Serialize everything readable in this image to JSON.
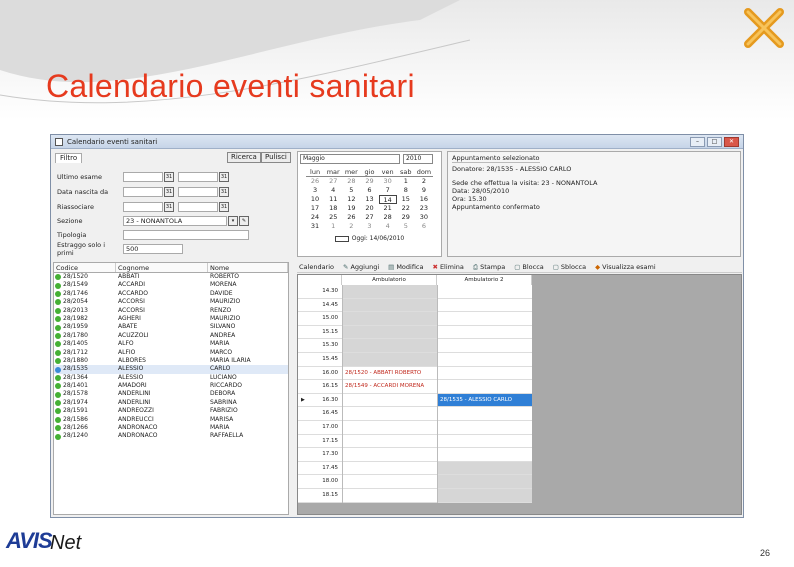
{
  "slide": {
    "title": "Calendario eventi sanitari",
    "page_number": "26",
    "logo_text_1": "AVIS",
    "logo_text_2": "Net"
  },
  "window": {
    "title": "Calendario eventi sanitari",
    "min": "–",
    "max": "□",
    "close": "✕"
  },
  "filter": {
    "tab": "Filtro",
    "buttons": {
      "search": "Ricerca",
      "clear": "Pulisci"
    },
    "fields": [
      {
        "label": "Ultimo esame",
        "value": ""
      },
      {
        "label": "Data nascita da",
        "value": ""
      },
      {
        "label": "Riassociare",
        "value": ""
      },
      {
        "label": "Sezione",
        "value": "23 - NONANTOLA"
      },
      {
        "label": "Tipologia",
        "value": ""
      },
      {
        "label": "Estraggo solo i primi",
        "value": "500"
      }
    ]
  },
  "calendar": {
    "month": "Maggio",
    "year": "2010",
    "days": [
      "lun",
      "mar",
      "mer",
      "gio",
      "ven",
      "sab",
      "dom"
    ],
    "weeks": [
      [
        "26",
        "27",
        "28",
        "29",
        "30",
        "1",
        "2"
      ],
      [
        "3",
        "4",
        "5",
        "6",
        "7",
        "8",
        "9"
      ],
      [
        "10",
        "11",
        "12",
        "13",
        "14",
        "15",
        "16"
      ],
      [
        "17",
        "18",
        "19",
        "20",
        "21",
        "22",
        "23"
      ],
      [
        "24",
        "25",
        "26",
        "27",
        "28",
        "29",
        "30"
      ],
      [
        "31",
        "1",
        "2",
        "3",
        "4",
        "5",
        "6"
      ]
    ],
    "today_label": "Oggi: 14/06/2010"
  },
  "appointment": {
    "header": "Appuntamento selezionato",
    "donor": "Donatore: 28/1535 - ALESSIO CARLO",
    "site": "Sede che effettua la visita: 23 - NONANTOLA",
    "date": "Data: 28/05/2010",
    "time": "Ora: 15.30",
    "status": "Appuntamento confermato"
  },
  "donors": {
    "columns": [
      "Codice",
      "Cognome",
      "Nome"
    ],
    "rows": [
      {
        "code": "28/1520",
        "surname": "ABBATI",
        "name": "ROBERTO",
        "selected": false
      },
      {
        "code": "28/1549",
        "surname": "ACCARDI",
        "name": "MORENA",
        "selected": false
      },
      {
        "code": "28/1746",
        "surname": "ACCARDO",
        "name": "DAVIDE",
        "selected": false
      },
      {
        "code": "28/2054",
        "surname": "ACCORSI",
        "name": "MAURIZIO",
        "selected": false
      },
      {
        "code": "28/2013",
        "surname": "ACCORSI",
        "name": "RENZO",
        "selected": false
      },
      {
        "code": "28/1982",
        "surname": "AGHERI",
        "name": "MAURIZIO",
        "selected": false
      },
      {
        "code": "28/1959",
        "surname": "ABATE",
        "name": "SILVANO",
        "selected": false
      },
      {
        "code": "28/1780",
        "surname": "ACUZZOLI",
        "name": "ANDREA",
        "selected": false
      },
      {
        "code": "28/1405",
        "surname": "ALFO",
        "name": "MARIA",
        "selected": false
      },
      {
        "code": "28/1712",
        "surname": "ALFIO",
        "name": "MARCO",
        "selected": false
      },
      {
        "code": "28/1880",
        "surname": "ALBORES",
        "name": "MARIA ILARIA",
        "selected": false
      },
      {
        "code": "28/1535",
        "surname": "ALESSIO",
        "name": "CARLO",
        "selected": true
      },
      {
        "code": "28/1364",
        "surname": "ALESSIO",
        "name": "LUCIANO",
        "selected": false
      },
      {
        "code": "28/1401",
        "surname": "AMADORI",
        "name": "RICCARDO",
        "selected": false
      },
      {
        "code": "28/1578",
        "surname": "ANDERLINI",
        "name": "DEBORA",
        "selected": false
      },
      {
        "code": "28/1974",
        "surname": "ANDERLINI",
        "name": "SABRINA",
        "selected": false
      },
      {
        "code": "28/1591",
        "surname": "ANDREOZZI",
        "name": "FABRIZIO",
        "selected": false
      },
      {
        "code": "28/1586",
        "surname": "ANDREUCCI",
        "name": "MARISA",
        "selected": false
      },
      {
        "code": "28/1266",
        "surname": "ANDRONACO",
        "name": "MARIA",
        "selected": false
      },
      {
        "code": "28/1240",
        "surname": "ANDRONACO",
        "name": "RAFFAELLA",
        "selected": false
      }
    ]
  },
  "toolbar": {
    "items": [
      "Calendario",
      "Aggiungi",
      "Modifica",
      "Elimina",
      "Stampa",
      "Blocca",
      "Sblocca",
      "Visualizza esami"
    ]
  },
  "schedule": {
    "columns": [
      "Ambulatorio",
      "Ambulatorio 2"
    ],
    "times": [
      "14.30",
      "14.45",
      "15.00",
      "15.15",
      "15.30",
      "15.45",
      "16.00",
      "16.15",
      "16.30",
      "16.45",
      "17.00",
      "17.15",
      "17.30",
      "17.45",
      "18.00",
      "18.15"
    ],
    "col1": [
      {
        "t": "",
        "s": "grey"
      },
      {
        "t": "",
        "s": "grey"
      },
      {
        "t": "",
        "s": "grey"
      },
      {
        "t": "",
        "s": "grey"
      },
      {
        "t": "",
        "s": "grey"
      },
      {
        "t": "",
        "s": "grey"
      },
      {
        "t": "28/1520 - ABBATI ROBERTO",
        "s": "red"
      },
      {
        "t": "28/1549 - ACCARDI MORENA",
        "s": "red"
      },
      {
        "t": "",
        "s": ""
      },
      {
        "t": "",
        "s": ""
      },
      {
        "t": "",
        "s": ""
      },
      {
        "t": "",
        "s": ""
      },
      {
        "t": "",
        "s": ""
      },
      {
        "t": "",
        "s": ""
      },
      {
        "t": "",
        "s": ""
      },
      {
        "t": "",
        "s": ""
      }
    ],
    "col2": [
      {
        "t": "",
        "s": ""
      },
      {
        "t": "",
        "s": ""
      },
      {
        "t": "",
        "s": ""
      },
      {
        "t": "",
        "s": ""
      },
      {
        "t": "",
        "s": ""
      },
      {
        "t": "",
        "s": ""
      },
      {
        "t": "",
        "s": ""
      },
      {
        "t": "",
        "s": ""
      },
      {
        "t": "28/1535 - ALESSIO CARLO",
        "s": "blue"
      },
      {
        "t": "",
        "s": ""
      },
      {
        "t": "",
        "s": ""
      },
      {
        "t": "",
        "s": ""
      },
      {
        "t": "",
        "s": ""
      },
      {
        "t": "",
        "s": "grey"
      },
      {
        "t": "",
        "s": "grey"
      },
      {
        "t": "",
        "s": "grey"
      }
    ]
  }
}
